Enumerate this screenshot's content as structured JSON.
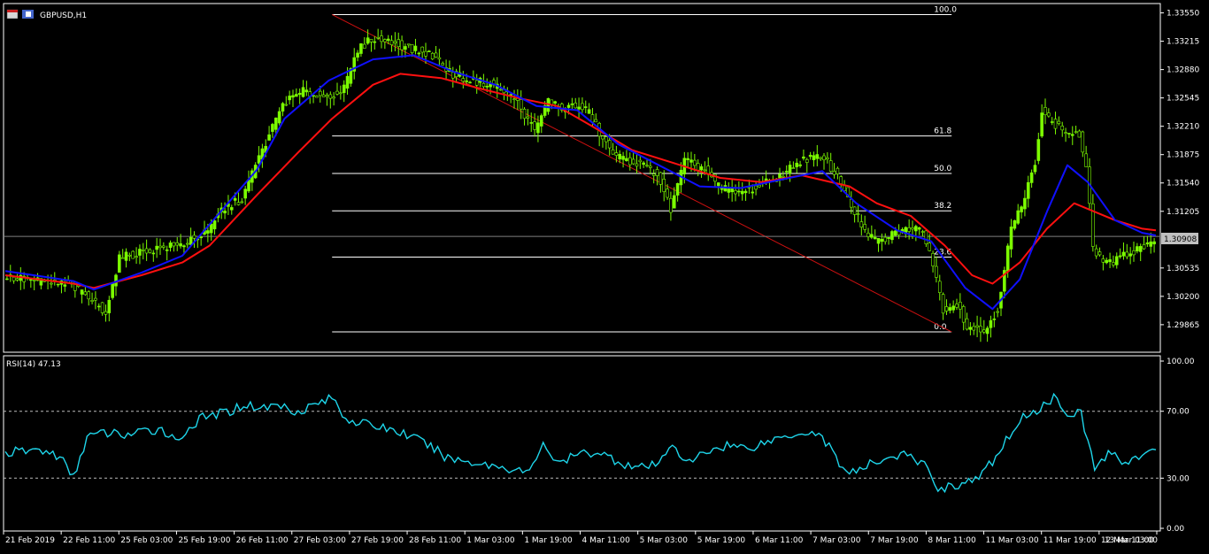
{
  "window": {
    "symbol_label": "GBPUSD,H1",
    "rsi_label": "RSI(14) 47.13",
    "current_price": "1.30908"
  },
  "colors": {
    "background": "#000000",
    "candle": "#7CFC00",
    "ma_fast": "#1010ff",
    "ma_slow": "#ff1010",
    "rsi": "#1ed5ea",
    "fib": "#ffffff",
    "trend": "#cc1010",
    "grid_text": "#ffffff"
  },
  "chart_data": [
    {
      "type": "candlestick",
      "title": "GBPUSD,H1",
      "ylim": [
        1.2955,
        1.3365
      ],
      "y_ticks": [
        "1.33550",
        "1.33215",
        "1.32880",
        "1.32545",
        "1.32210",
        "1.31875",
        "1.31540",
        "1.31205",
        "1.30535",
        "1.30200",
        "1.29865"
      ],
      "y_tick_values": [
        1.3355,
        1.33215,
        1.3288,
        1.32545,
        1.3221,
        1.31875,
        1.3154,
        1.31205,
        1.30535,
        1.302,
        1.29865
      ],
      "x_ticks": [
        "21 Feb 2019",
        "22 Feb 11:00",
        "25 Feb 03:00",
        "25 Feb 19:00",
        "26 Feb 11:00",
        "27 Feb 03:00",
        "27 Feb 19:00",
        "28 Feb 11:00",
        "1 Mar 03:00",
        "1 Mar 19:00",
        "4 Mar 11:00",
        "5 Mar 03:00",
        "5 Mar 19:00",
        "6 Mar 11:00",
        "7 Mar 03:00",
        "7 Mar 19:00",
        "8 Mar 11:00",
        "11 Mar 03:00",
        "11 Mar 19:00",
        "12 Mar 11:00",
        "13 Mar 03:00"
      ],
      "price_path": [
        [
          0,
          1.3043
        ],
        [
          10,
          1.3038
        ],
        [
          20,
          1.3033
        ],
        [
          26,
          1.3015
        ],
        [
          30,
          1.3002
        ],
        [
          34,
          1.3065
        ],
        [
          40,
          1.3072
        ],
        [
          47,
          1.3078
        ],
        [
          52,
          1.308
        ],
        [
          55,
          1.3088
        ],
        [
          60,
          1.3095
        ],
        [
          64,
          1.3122
        ],
        [
          70,
          1.3135
        ],
        [
          74,
          1.3175
        ],
        [
          78,
          1.321
        ],
        [
          82,
          1.3248
        ],
        [
          88,
          1.3262
        ],
        [
          95,
          1.3255
        ],
        [
          100,
          1.3265
        ],
        [
          104,
          1.331
        ],
        [
          108,
          1.3325
        ],
        [
          112,
          1.3322
        ],
        [
          116,
          1.3318
        ],
        [
          120,
          1.3312
        ],
        [
          126,
          1.3305
        ],
        [
          132,
          1.3282
        ],
        [
          138,
          1.3275
        ],
        [
          144,
          1.327
        ],
        [
          150,
          1.3255
        ],
        [
          156,
          1.3215
        ],
        [
          160,
          1.3252
        ],
        [
          164,
          1.3242
        ],
        [
          168,
          1.3245
        ],
        [
          172,
          1.3238
        ],
        [
          176,
          1.3205
        ],
        [
          180,
          1.3185
        ],
        [
          186,
          1.3178
        ],
        [
          192,
          1.3165
        ],
        [
          196,
          1.3122
        ],
        [
          200,
          1.318
        ],
        [
          206,
          1.317
        ],
        [
          210,
          1.315
        ],
        [
          216,
          1.3142
        ],
        [
          222,
          1.315
        ],
        [
          228,
          1.3162
        ],
        [
          234,
          1.318
        ],
        [
          238,
          1.3185
        ],
        [
          242,
          1.3178
        ],
        [
          246,
          1.3155
        ],
        [
          250,
          1.312
        ],
        [
          254,
          1.309
        ],
        [
          258,
          1.3085
        ],
        [
          262,
          1.3095
        ],
        [
          266,
          1.31
        ],
        [
          270,
          1.3098
        ],
        [
          272,
          1.3075
        ],
        [
          276,
          1.3005
        ],
        [
          280,
          1.3012
        ],
        [
          283,
          1.2985
        ],
        [
          288,
          1.2978
        ],
        [
          292,
          1.3005
        ],
        [
          296,
          1.31
        ],
        [
          300,
          1.3135
        ],
        [
          303,
          1.318
        ],
        [
          305,
          1.324
        ],
        [
          308,
          1.3225
        ],
        [
          312,
          1.3215
        ],
        [
          316,
          1.321
        ],
        [
          318,
          1.317
        ],
        [
          320,
          1.308
        ],
        [
          322,
          1.3065
        ],
        [
          326,
          1.306
        ],
        [
          330,
          1.307
        ],
        [
          334,
          1.3078
        ],
        [
          338,
          1.3088
        ]
      ],
      "ma_fast": [
        [
          0,
          1.305
        ],
        [
          20,
          1.3038
        ],
        [
          26,
          1.3028
        ],
        [
          40,
          1.3048
        ],
        [
          52,
          1.3068
        ],
        [
          60,
          1.3105
        ],
        [
          74,
          1.317
        ],
        [
          82,
          1.323
        ],
        [
          95,
          1.3275
        ],
        [
          108,
          1.33
        ],
        [
          120,
          1.3305
        ],
        [
          132,
          1.3285
        ],
        [
          144,
          1.327
        ],
        [
          156,
          1.3245
        ],
        [
          168,
          1.324
        ],
        [
          180,
          1.32
        ],
        [
          192,
          1.3175
        ],
        [
          204,
          1.315
        ],
        [
          216,
          1.3148
        ],
        [
          228,
          1.3158
        ],
        [
          240,
          1.3168
        ],
        [
          250,
          1.313
        ],
        [
          262,
          1.3098
        ],
        [
          272,
          1.3085
        ],
        [
          282,
          1.303
        ],
        [
          290,
          1.3005
        ],
        [
          298,
          1.304
        ],
        [
          306,
          1.312
        ],
        [
          312,
          1.3175
        ],
        [
          318,
          1.3155
        ],
        [
          326,
          1.311
        ],
        [
          334,
          1.3095
        ],
        [
          338,
          1.3092
        ]
      ],
      "ma_slow": [
        [
          0,
          1.3045
        ],
        [
          20,
          1.3035
        ],
        [
          26,
          1.303
        ],
        [
          40,
          1.3045
        ],
        [
          52,
          1.306
        ],
        [
          60,
          1.308
        ],
        [
          74,
          1.314
        ],
        [
          86,
          1.319
        ],
        [
          96,
          1.323
        ],
        [
          108,
          1.327
        ],
        [
          116,
          1.3283
        ],
        [
          128,
          1.3278
        ],
        [
          140,
          1.3265
        ],
        [
          150,
          1.3255
        ],
        [
          162,
          1.3245
        ],
        [
          172,
          1.3222
        ],
        [
          184,
          1.3193
        ],
        [
          196,
          1.3178
        ],
        [
          210,
          1.316
        ],
        [
          222,
          1.3155
        ],
        [
          234,
          1.3163
        ],
        [
          248,
          1.315
        ],
        [
          256,
          1.313
        ],
        [
          266,
          1.3115
        ],
        [
          276,
          1.308
        ],
        [
          284,
          1.3045
        ],
        [
          290,
          1.3035
        ],
        [
          298,
          1.306
        ],
        [
          306,
          1.31
        ],
        [
          314,
          1.313
        ],
        [
          326,
          1.311
        ],
        [
          334,
          1.31
        ],
        [
          338,
          1.3098
        ]
      ],
      "fib_levels": [
        {
          "label": "100.0",
          "value": 1.3353
        },
        {
          "label": "61.8",
          "value": 1.32095
        },
        {
          "label": "50.0",
          "value": 1.31652
        },
        {
          "label": "38.2",
          "value": 1.31211
        },
        {
          "label": "23.6",
          "value": 1.30664
        },
        {
          "label": "0.0",
          "value": 1.2978
        }
      ],
      "trend_line": [
        [
          96,
          1.3353
        ],
        [
          278,
          1.2978
        ]
      ],
      "current_price": 1.30908
    },
    {
      "type": "line",
      "title": "RSI(14) 47.13",
      "ylim": [
        0,
        100
      ],
      "y_ticks": [
        "100.00",
        "70.00",
        "30.00",
        "0.00"
      ],
      "y_tick_values": [
        100,
        70,
        30,
        0
      ],
      "levels": [
        70,
        30
      ],
      "values": [
        [
          0,
          45
        ],
        [
          10,
          47
        ],
        [
          16,
          43
        ],
        [
          20,
          30
        ],
        [
          24,
          55
        ],
        [
          30,
          57
        ],
        [
          36,
          56
        ],
        [
          42,
          58
        ],
        [
          46,
          60
        ],
        [
          50,
          52
        ],
        [
          54,
          60
        ],
        [
          58,
          66
        ],
        [
          62,
          68
        ],
        [
          66,
          70
        ],
        [
          70,
          74
        ],
        [
          76,
          72
        ],
        [
          80,
          74
        ],
        [
          86,
          70
        ],
        [
          92,
          75
        ],
        [
          96,
          78
        ],
        [
          100,
          66
        ],
        [
          106,
          62
        ],
        [
          112,
          60
        ],
        [
          118,
          56
        ],
        [
          124,
          50
        ],
        [
          130,
          42
        ],
        [
          136,
          40
        ],
        [
          142,
          38
        ],
        [
          148,
          36
        ],
        [
          154,
          33
        ],
        [
          158,
          52
        ],
        [
          162,
          38
        ],
        [
          168,
          44
        ],
        [
          174,
          46
        ],
        [
          180,
          40
        ],
        [
          186,
          36
        ],
        [
          192,
          38
        ],
        [
          196,
          52
        ],
        [
          200,
          38
        ],
        [
          206,
          46
        ],
        [
          212,
          50
        ],
        [
          218,
          48
        ],
        [
          224,
          52
        ],
        [
          230,
          56
        ],
        [
          236,
          58
        ],
        [
          240,
          55
        ],
        [
          246,
          36
        ],
        [
          250,
          33
        ],
        [
          254,
          38
        ],
        [
          258,
          42
        ],
        [
          264,
          44
        ],
        [
          270,
          38
        ],
        [
          274,
          24
        ],
        [
          280,
          26
        ],
        [
          286,
          30
        ],
        [
          292,
          45
        ],
        [
          296,
          60
        ],
        [
          300,
          68
        ],
        [
          304,
          72
        ],
        [
          308,
          78
        ],
        [
          312,
          70
        ],
        [
          316,
          68
        ],
        [
          320,
          36
        ],
        [
          324,
          45
        ],
        [
          328,
          40
        ],
        [
          332,
          42
        ],
        [
          336,
          44
        ],
        [
          338,
          47
        ]
      ]
    }
  ]
}
